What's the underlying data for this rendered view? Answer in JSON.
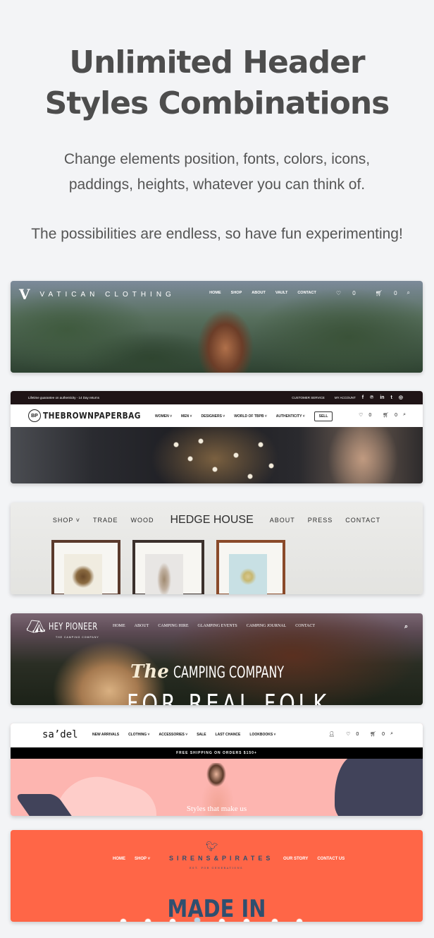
{
  "hero": {
    "title_line1": "Unlimited Header",
    "title_line2": "Styles Combinations",
    "subtitle_line1": "Change elements position, fonts, colors, icons,",
    "subtitle_line2": "paddings, heights, whatever you can think of.",
    "tagline": "The possibilities are endless, so have fun experimenting!"
  },
  "headers": [
    {
      "brand": "VATICAN CLOTHING",
      "brand_mark": "V",
      "nav": [
        "HOME",
        "SHOP",
        "ABOUT",
        "VAULT",
        "CONTACT"
      ],
      "icons": {
        "wishlist": "♡",
        "wishlist_count": "0",
        "cart": "🛒︎",
        "cart_count": "0",
        "search": "⌕"
      }
    },
    {
      "topbar_promo": "Lifetime guarantee on authenticity - 14 Day returns",
      "topbar_links": [
        "CUSTOMER SERVICE",
        "MY ACCOUNT"
      ],
      "social": [
        "f",
        "℗",
        "in",
        "t",
        "◎"
      ],
      "brand": "THEBROWNPAPERBAG",
      "brand_mark": "BP",
      "nav": [
        "WOMEN ˅",
        "MEN ˅",
        "DESIGNERS ˅",
        "WORLD OF TBPB ˅",
        "AUTHENTICITY ˅"
      ],
      "sell_label": "SELL",
      "icons": {
        "wishlist": "♡",
        "wishlist_count": "0",
        "cart": "🛒︎",
        "cart_count": "0",
        "search": "⌕"
      }
    },
    {
      "nav_left": [
        "SHOP ˅",
        "TRADE",
        "WOOD"
      ],
      "brand": "HEDGE HOUSE",
      "nav_right": [
        "ABOUT",
        "PRESS",
        "CONTACT"
      ]
    },
    {
      "brand": "HEY PIONEER",
      "brand_tagline": "THE CAMPING COMPANY",
      "nav": [
        "HOME",
        "ABOUT",
        "CAMPING HIRE",
        "GLAMPING EVENTS",
        "CAMPING JOURNAL",
        "CONTACT"
      ],
      "search": "⌕",
      "hero_the": "The",
      "hero_line1": "CAMPING COMPANY",
      "hero_line2": "FOR REAL FOLK"
    },
    {
      "brand": "sa’del",
      "nav": [
        "NEW ARRIVALS",
        "CLOTHING ˅",
        "ACCESSORIES ˅",
        "SALE",
        "LAST CHANCE",
        "LOOKBOOKS ˅"
      ],
      "icons": {
        "account": "👤︎",
        "wishlist": "♡",
        "wishlist_count": "0",
        "cart": "🛒︎",
        "cart_count": "0",
        "search": "⌕"
      },
      "promo": "FREE SHIPPING ON ORDERS $150+",
      "caption": "Styles that make us"
    },
    {
      "nav_left": [
        "HOME",
        "SHOP ˅"
      ],
      "brand": "SIRENS&PIRATES",
      "brand_tagline": "EST. FOR GENERATIONS",
      "nav_right": [
        "OUR STORY",
        "CONTACT US"
      ],
      "hero_text": "MADE IN"
    }
  ]
}
